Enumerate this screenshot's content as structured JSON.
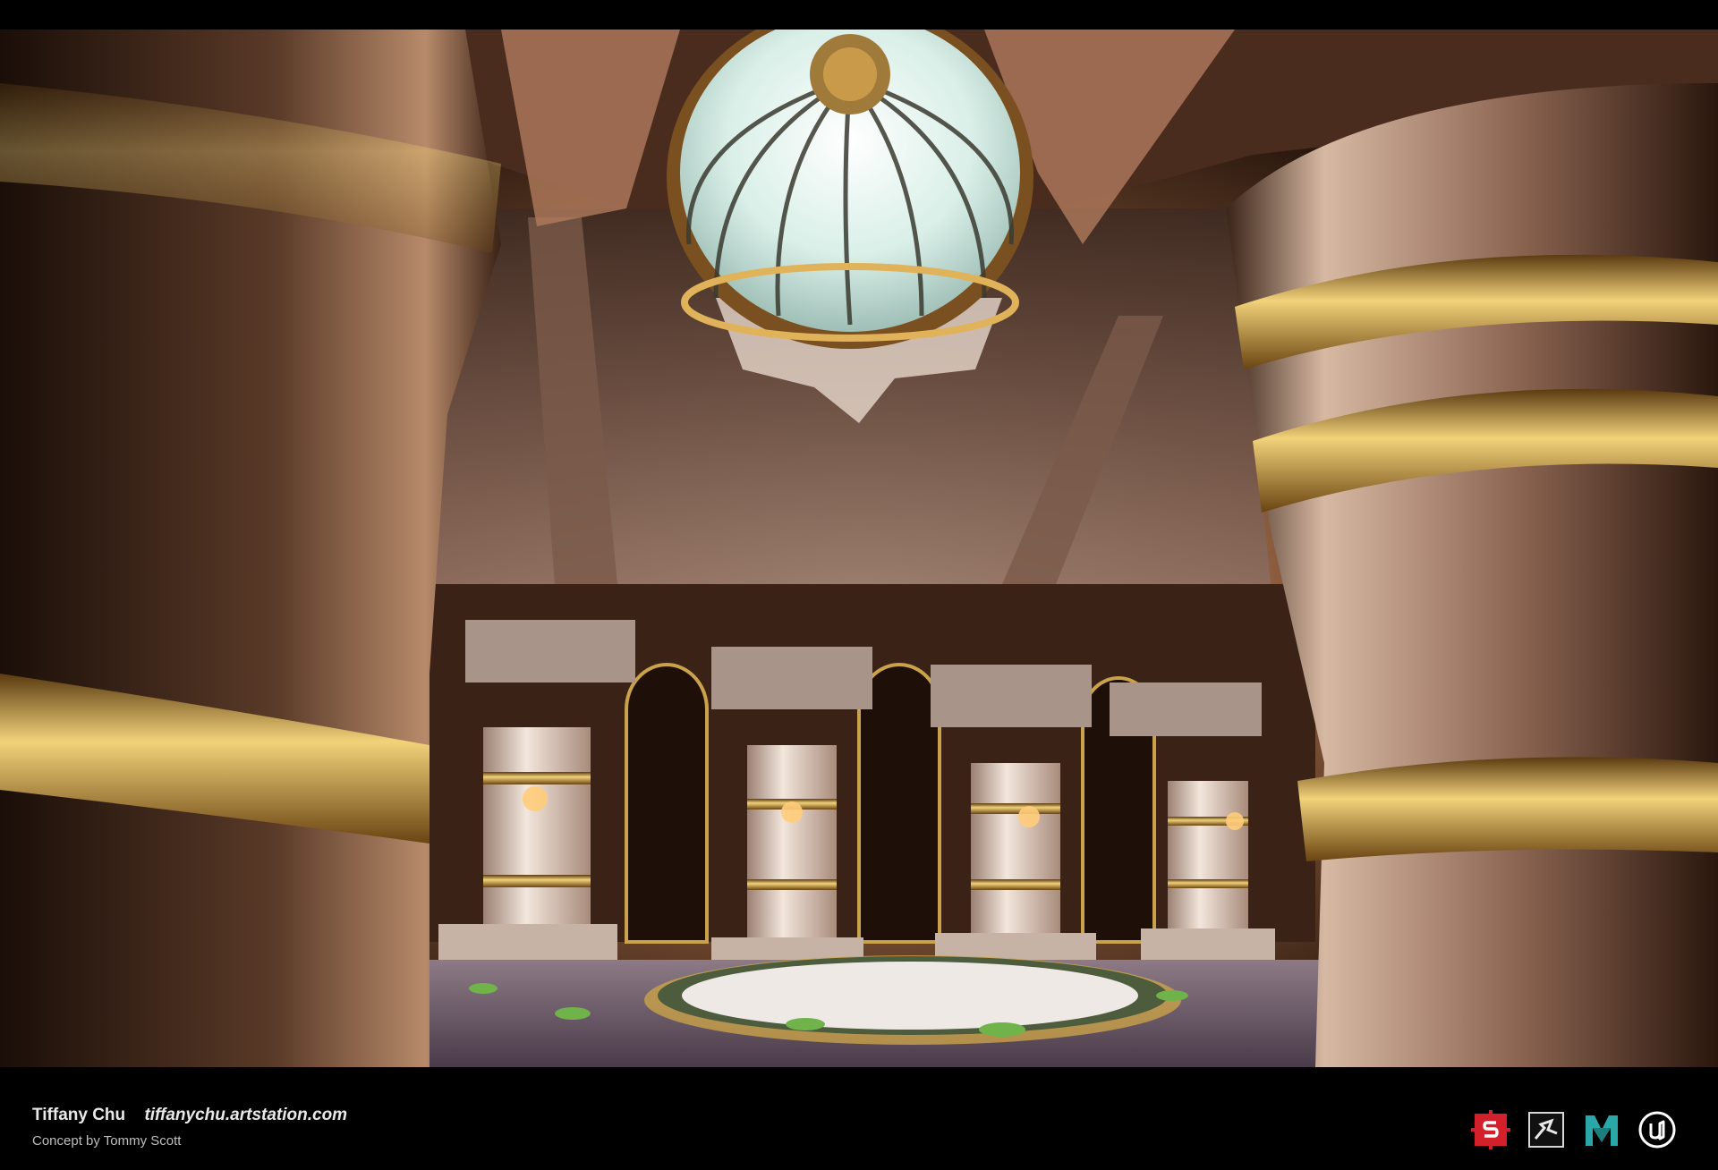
{
  "caption": {
    "artist": "Tiffany Chu",
    "url": "tiffanychu.artstation.com",
    "credit": "Concept by Tommy Scott"
  },
  "tools": [
    {
      "icon": "substance-painter-icon",
      "color": "#d4202a"
    },
    {
      "icon": "zbrush-icon",
      "color": "#d8d8d8"
    },
    {
      "icon": "maya-icon",
      "color": "#2aa7a8"
    },
    {
      "icon": "unreal-engine-icon",
      "color": "#ffffff"
    }
  ],
  "colors": {
    "background": "#000000",
    "caption_text": "#e8e8e8",
    "credit_text": "#bdbdbd",
    "gold": "#c9a24a",
    "marble": "#d9c9bd"
  }
}
